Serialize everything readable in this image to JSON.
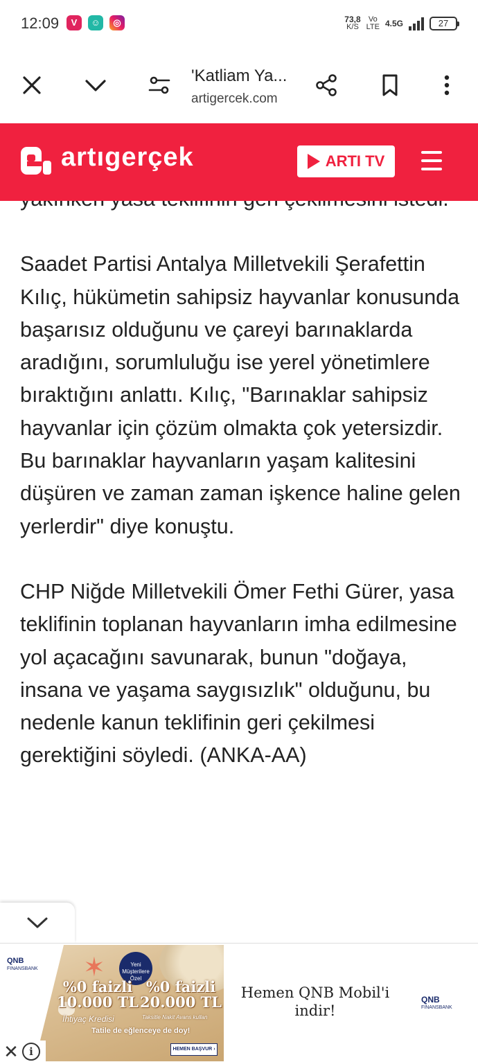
{
  "status_bar": {
    "time": "12:09",
    "app_icons": [
      "app-icon-1",
      "snapchat-icon",
      "instagram-icon"
    ],
    "net_speed_value": "73,8",
    "net_speed_unit": "K/S",
    "volte_top": "Vo",
    "volte_bottom": "LTE",
    "network": "4.5G",
    "battery": "27"
  },
  "browser": {
    "page_title": "'Katliam Ya...",
    "domain": "artigercek.com",
    "icons": [
      "close-icon",
      "chevron-down-icon",
      "site-settings-icon",
      "share-icon",
      "bookmark-icon",
      "more-icon"
    ]
  },
  "site_header": {
    "logo_text": "artıgerçek",
    "tv_label": "ARTI TV",
    "colors": {
      "brand": "#f0213f",
      "text": "#ffffff"
    }
  },
  "article": {
    "partial_line": "yakınken yasa teklifinin geri çekilmesini istedi.",
    "paragraphs": [
      "Saadet Partisi Antalya Milletvekili Şerafettin Kılıç, hükümetin sahipsiz hayvanlar konusunda başarısız olduğunu ve çareyi barınaklarda aradığını, sorumluluğu ise yerel yönetimlere bıraktığını anlattı. Kılıç, \"Barınaklar sahipsiz hayvanlar için çözüm olmakta çok yetersizdir. Bu barınaklar hayvanların yaşam kalitesini düşüren ve zaman zaman işkence haline gelen yerlerdir\" diye konuştu.",
      "CHP Niğde Milletvekili Ömer Fethi Gürer, yasa teklifinin toplanan hayvanların imha edilmesine yol açacağını savunarak, bunun \"doğaya, insana ve yaşama saygısızlık\" olduğunu, bu nedenle kanun teklifinin geri çekilmesi gerektiğini söyledi. (ANKA-AA)"
    ]
  },
  "ad": {
    "brand": "QNB",
    "brand_sub": "FINANSBANK",
    "badge_line1": "Yeni",
    "badge_line2": "Müşterilere",
    "badge_line3": "Özel",
    "offer1_line1": "%0 faizli",
    "offer1_line2": "10.000 TL",
    "offer1_sub": "İhtiyaç Kredisi",
    "offer2_line1": "%0 faizli",
    "offer2_line2": "20.000 TL",
    "offer2_sub": "Taksitle Nakit Avans kullan",
    "tagline": "Tatile de eğlenceye de doy!",
    "cta": "HEMEN BAŞVUR",
    "headline": "Hemen QNB Mobil'i indir!",
    "close_symbol": "✕",
    "info_symbol": "i"
  }
}
